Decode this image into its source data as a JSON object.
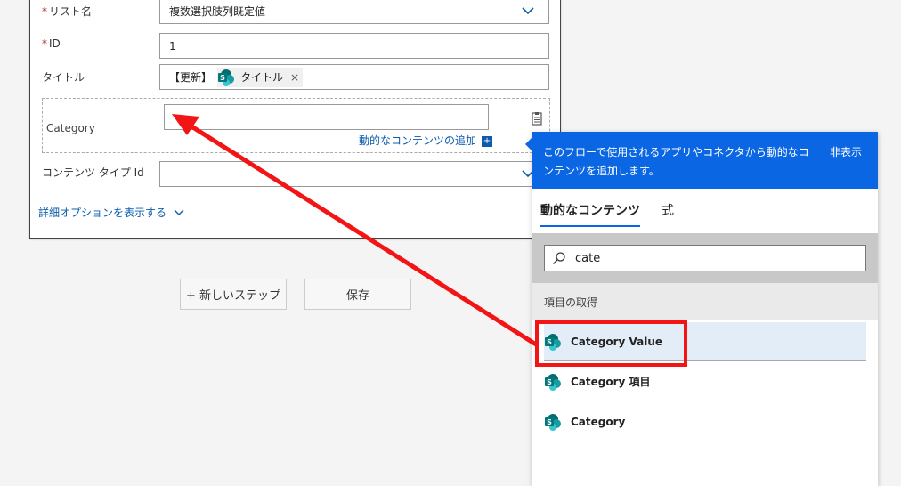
{
  "form": {
    "list_name": {
      "label": "リスト名",
      "value": "複数選択肢列既定値"
    },
    "id": {
      "label": "ID",
      "value": "1"
    },
    "title": {
      "label": "タイトル",
      "prefix": "【更新】",
      "token": "タイトル",
      "token_close": "×"
    },
    "category": {
      "label": "Category",
      "add_dynamic": "動的なコンテンツの追加",
      "add_icon": "+"
    },
    "content_type": {
      "label": "コンテンツ タイプ Id",
      "value": ""
    },
    "advanced": "詳細オプションを表示する",
    "required_mark": "*"
  },
  "actions": {
    "new_step": "+ 新しいステップ",
    "save": "保存"
  },
  "panel": {
    "description": "このフローで使用されるアプリやコネクタから動的なコンテンツを追加します。",
    "hide": "非表示",
    "tabs": [
      "動的なコンテンツ",
      "式"
    ],
    "search": {
      "value": "cate"
    },
    "section_title": "項目の取得",
    "items": [
      "Category Value",
      "Category 項目",
      "Category"
    ]
  },
  "colors": {
    "accent": "#0b66e4",
    "highlight": "#f31515",
    "sharepoint": "#038387"
  }
}
